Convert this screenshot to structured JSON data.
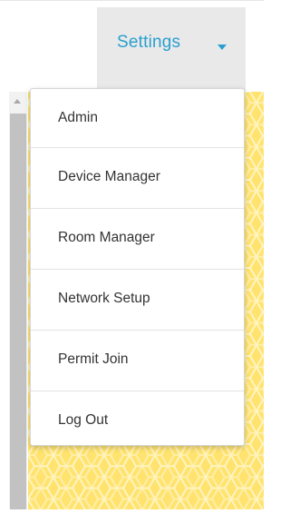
{
  "header": {
    "settings_label": "Settings",
    "accent_color": "#2a9fd0",
    "caret_icon": "caret-down-icon"
  },
  "dropdown": {
    "items": [
      {
        "label": "Admin"
      },
      {
        "label": "Device Manager"
      },
      {
        "label": "Room Manager"
      },
      {
        "label": "Network Setup"
      },
      {
        "label": "Permit Join"
      },
      {
        "label": "Log Out"
      }
    ]
  },
  "background": {
    "pattern": "honeycomb",
    "color": "#ffe36e"
  }
}
